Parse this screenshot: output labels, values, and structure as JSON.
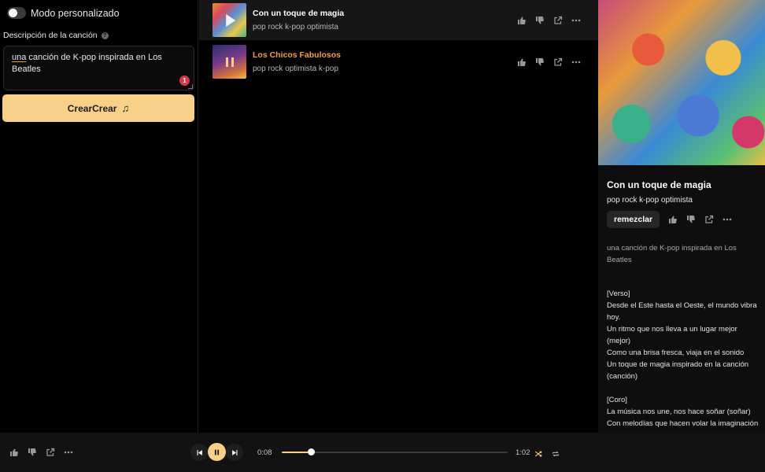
{
  "left": {
    "toggle_label": "Modo personalizado",
    "description_label": "Descripción de la canción",
    "description_text_first": "una",
    "description_text_rest": " canción de K-pop inspirada en Los Beatles",
    "error_count": "1",
    "create_button": "CrearCrear"
  },
  "songs": [
    {
      "title": "Con un toque de magia",
      "tags": "pop rock k-pop optimista",
      "state": "hover"
    },
    {
      "title": "Los Chicos Fabulosos",
      "tags": "pop rock optimista k-pop",
      "state": "playing"
    }
  ],
  "detail": {
    "title": "Con un toque de magia",
    "tags": "pop rock k-pop optimista",
    "remix_button": "remezclar",
    "prompt": "una canción de K-pop inspirada en Los Beatles",
    "lyrics": "[Verso]\nDesde el Este hasta el Oeste, el mundo vibra hoy.\nUn ritmo que nos lleva a un lugar mejor (mejor)\nComo una brisa fresca, viaja en el sonido\nUn toque de magia inspirado en la canción (canción)\n\n[Coro]\nLa música nos une, nos hace soñar (soñar)\nCon melodías que hacen volar la imaginación"
  },
  "player": {
    "current_time": "0:08",
    "duration": "1:02",
    "progress_fraction": 0.13
  },
  "colors": {
    "accent": "#f7d08a",
    "playing_title": "#f0a04a",
    "error_badge": "#d4384a"
  },
  "icons": [
    "thumbs-up-icon",
    "thumbs-down-icon",
    "share-icon",
    "more-icon",
    "play-icon",
    "pause-icon",
    "previous-icon",
    "next-icon",
    "shuffle-icon",
    "repeat-icon",
    "music-note-icon",
    "help-icon"
  ]
}
